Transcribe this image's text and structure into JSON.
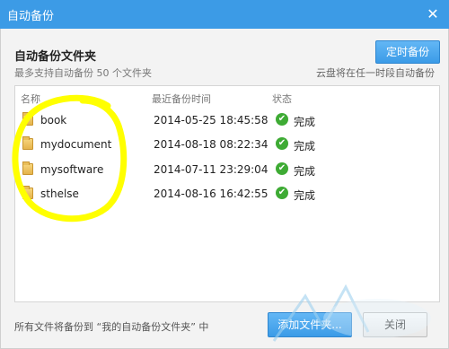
{
  "window": {
    "title": "自动备份",
    "close_glyph": "✕"
  },
  "header": {
    "section_title": "自动备份文件夹",
    "subtitle": "最多支持自动备份 50 个文件夹",
    "right_hint": "云盘将在任一时段自动备份",
    "timer_button": "定时备份"
  },
  "list": {
    "columns": {
      "name": "名称",
      "time": "最近备份时间",
      "status": "状态"
    },
    "rows": [
      {
        "name": "book",
        "time": "2014-05-25 18:45:58",
        "status": "完成"
      },
      {
        "name": "mydocument",
        "time": "2014-08-18 08:22:34",
        "status": "完成"
      },
      {
        "name": "mysoftware",
        "time": "2014-07-11 23:29:04",
        "status": "完成"
      },
      {
        "name": "sthelse",
        "time": "2014-08-16 16:42:55",
        "status": "完成"
      }
    ]
  },
  "footer": {
    "note": "所有文件将备份到 “我的自动备份文件夹” 中",
    "add_button": "添加文件夹...",
    "close_button": "关闭"
  },
  "colors": {
    "titlebar": "#3c9be6",
    "primary_button": "#3b9be7",
    "status_ok": "#3eab34",
    "annotation": "#ffff00"
  },
  "icons": {
    "folder": "folder-icon",
    "status": "check-icon",
    "close": "close-icon"
  }
}
